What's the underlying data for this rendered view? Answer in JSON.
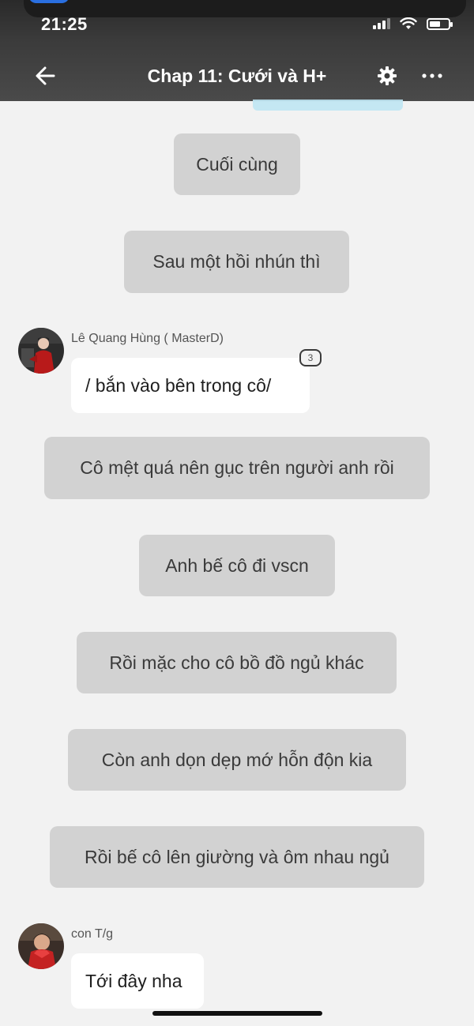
{
  "status_bar": {
    "time": "21:25"
  },
  "header": {
    "title": "Chap 11: Cưới và H+"
  },
  "messages": {
    "m1": "Cuối cùng",
    "m2": "Sau một hồi nhún thì",
    "m3_author": "Lê Quang Hùng ( MasterD)",
    "m3_text": "/ bắn vào bên trong cô/",
    "m3_badge": "3",
    "m4": "Cô mệt quá nên gục trên người anh rồi",
    "m5": "Anh bế cô đi vscn",
    "m6": "Rồi mặc cho cô bồ đồ ngủ khác",
    "m7": "Còn anh dọn dẹp mớ hỗn độn kia",
    "m8": "Rồi bế cô lên giường và ôm nhau ngủ",
    "m9_author": "con T/g",
    "m9_text": "Tới đây nha"
  },
  "icons": {
    "back": "back-arrow-icon",
    "settings": "gear-icon",
    "more": "more-icon"
  }
}
